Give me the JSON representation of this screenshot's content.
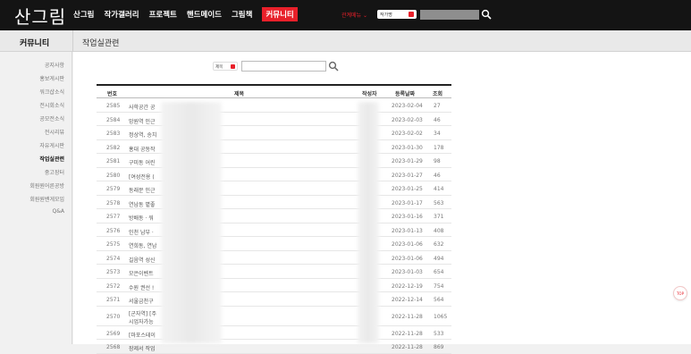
{
  "header": {
    "logo": "산그림",
    "nav": [
      "산그림",
      "작가갤러리",
      "프로젝트",
      "핸드메이드",
      "그림책",
      "커뮤니티"
    ],
    "active_nav_index": 5,
    "quick_menu_label": "관계메뉴 ⌄",
    "search_select": "작가명",
    "accent_color": "#e8202a"
  },
  "subheader": {
    "section_title": "커뮤니티",
    "page_title": "작업실관련"
  },
  "sidebar": {
    "items": [
      "공지사항",
      "홍보게시판",
      "워크샵소식",
      "전시회소식",
      "공모전소식",
      "전시리뷰",
      "자유게시판",
      "작업실관련",
      "중고장터",
      "회원원어른공방",
      "회원원밴게모임",
      "Q&A"
    ],
    "current_index": 7
  },
  "board_search": {
    "select_label": "제목"
  },
  "table": {
    "headers": [
      "번호",
      "제목",
      "작성자",
      "등록날짜",
      "조회"
    ],
    "rows": [
      {
        "num": "2585",
        "title": "사학공간 공",
        "date": "2023-02-04",
        "views": "27"
      },
      {
        "num": "2584",
        "title": "망원역 인근",
        "date": "2023-02-03",
        "views": "46"
      },
      {
        "num": "2583",
        "title": "정상역, 송치",
        "date": "2023-02-02",
        "views": "34"
      },
      {
        "num": "2582",
        "title": "홍대 공동작",
        "date": "2023-01-30",
        "views": "178"
      },
      {
        "num": "2581",
        "title": "구미동 어린",
        "date": "2023-01-29",
        "views": "98"
      },
      {
        "num": "2580",
        "title": "[여성전용 (",
        "date": "2023-01-27",
        "views": "46"
      },
      {
        "num": "2579",
        "title": "동래문 인근",
        "date": "2023-01-25",
        "views": "414"
      },
      {
        "num": "2578",
        "title": "연남동 볕좋",
        "date": "2023-01-17",
        "views": "563"
      },
      {
        "num": "2577",
        "title": "방배동 · 워",
        "date": "2023-01-16",
        "views": "371"
      },
      {
        "num": "2576",
        "title": "인천 남부 ·",
        "date": "2023-01-13",
        "views": "408"
      },
      {
        "num": "2575",
        "title": "연희동, 연남",
        "date": "2023-01-06",
        "views": "632"
      },
      {
        "num": "2574",
        "title": "길음역 성신",
        "date": "2023-01-06",
        "views": "494"
      },
      {
        "num": "2573",
        "title": "모은이벤트",
        "date": "2023-01-03",
        "views": "654"
      },
      {
        "num": "2572",
        "title": "수원 권선 !",
        "date": "2022-12-19",
        "views": "754"
      },
      {
        "num": "2571",
        "title": "서울금천구",
        "date": "2022-12-14",
        "views": "564"
      },
      {
        "num": "2570",
        "title": "[군자역] [주",
        "title2": "시업자가능",
        "date": "2022-11-28",
        "views": "1065"
      },
      {
        "num": "2569",
        "title": "[마포스테이",
        "date": "2022-11-28",
        "views": "533"
      },
      {
        "num": "2568",
        "title": "장제서 작업",
        "date": "2022-11-28",
        "views": "869"
      }
    ]
  },
  "top_button": "TOP"
}
